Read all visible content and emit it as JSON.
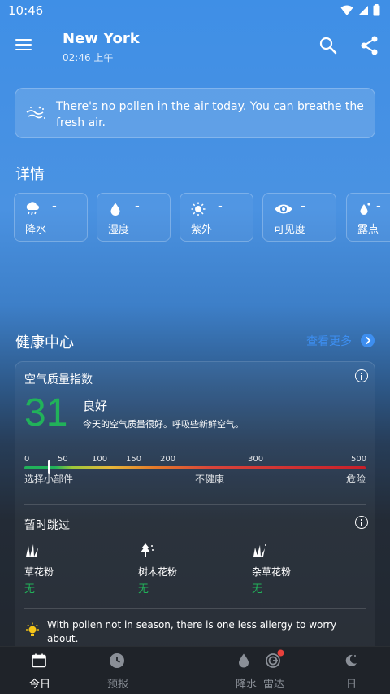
{
  "status_bar": {
    "time": "10:46"
  },
  "header": {
    "city": "New York",
    "local_time": "02:46 上午"
  },
  "pollen_banner": {
    "message": "There's no pollen in the air today. You can breathe the fresh air."
  },
  "details": {
    "title": "详情",
    "items": [
      {
        "icon": "rain-icon",
        "value": "-",
        "label": "降水"
      },
      {
        "icon": "humidity-drop-icon",
        "value": "-",
        "label": "湿度"
      },
      {
        "icon": "sun-uv-icon",
        "value": "-",
        "label": "紫外"
      },
      {
        "icon": "eye-visibility-icon",
        "value": "-",
        "label": "可见度"
      },
      {
        "icon": "dew-point-icon",
        "value": "-",
        "label": "露点"
      }
    ]
  },
  "health": {
    "title": "健康中心",
    "see_more": "查看更多",
    "aqi": {
      "title": "空气质量指数",
      "value": "31",
      "status": "良好",
      "description": "今天的空气质量很好。呼吸些新鲜空气。",
      "ticks": [
        "0",
        "50",
        "100",
        "150",
        "200",
        "300",
        "500"
      ],
      "scale_labels": [
        "选择小部件",
        "不健康",
        "危险"
      ],
      "color": "#21b25a"
    },
    "pollen": {
      "title": "暂时跳过",
      "types": [
        {
          "icon": "grass-icon",
          "label": "草花粉",
          "value": "无"
        },
        {
          "icon": "tree-icon",
          "label": "树木花粉",
          "value": "无"
        },
        {
          "icon": "weed-icon",
          "label": "杂草花粉",
          "value": "无"
        }
      ],
      "tip": "With pollen not in season, there is one less allergy to worry about."
    }
  },
  "bottom_nav": {
    "items": [
      {
        "label": "今日",
        "active": true
      },
      {
        "label": "预报",
        "active": false
      },
      {
        "label": "降水",
        "active": false
      },
      {
        "label": "雷达",
        "active": false
      },
      {
        "label": "日",
        "active": false
      }
    ]
  }
}
